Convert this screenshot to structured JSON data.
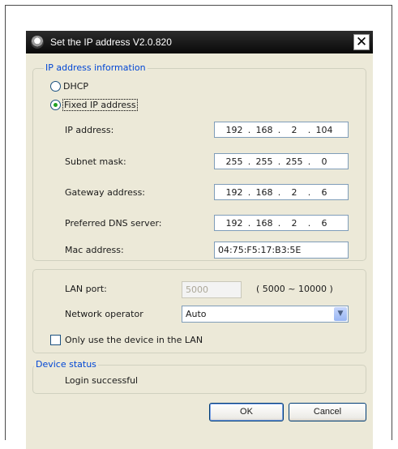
{
  "window": {
    "title": "Set the IP address  V2.0.820",
    "close_glyph": "✕"
  },
  "ip_group": {
    "legend": "IP address information",
    "dhcp_label": "DHCP",
    "dhcp_selected": false,
    "fixed_label": "Fixed IP address",
    "fixed_selected": true,
    "fields": [
      {
        "label": "IP address:",
        "octets": [
          "192",
          "168",
          "2",
          "104"
        ]
      },
      {
        "label": "Subnet mask:",
        "octets": [
          "255",
          "255",
          "255",
          "0"
        ]
      },
      {
        "label": "Gateway address:",
        "octets": [
          "192",
          "168",
          "2",
          "6"
        ]
      },
      {
        "label": "Preferred DNS server:",
        "octets": [
          "192",
          "168",
          "2",
          "6"
        ]
      }
    ],
    "mac_label": "Mac address:",
    "mac_value": "04:75:F5:17:B3:5E"
  },
  "lan_group": {
    "port_label": "LAN port:",
    "port_value": "5000",
    "port_range": "( 5000 ~ 10000 )",
    "operator_label": "Network operator",
    "operator_value": "Auto",
    "lan_only_label": "Only use the device in the LAN",
    "lan_only_checked": false
  },
  "status_group": {
    "legend": "Device status",
    "text": "Login successful"
  },
  "buttons": {
    "ok": "OK",
    "cancel": "Cancel"
  },
  "colors": {
    "titlebar": "#0b0b0b",
    "dialog_bg": "#ece9d8",
    "legend_text": "#0046d5"
  }
}
